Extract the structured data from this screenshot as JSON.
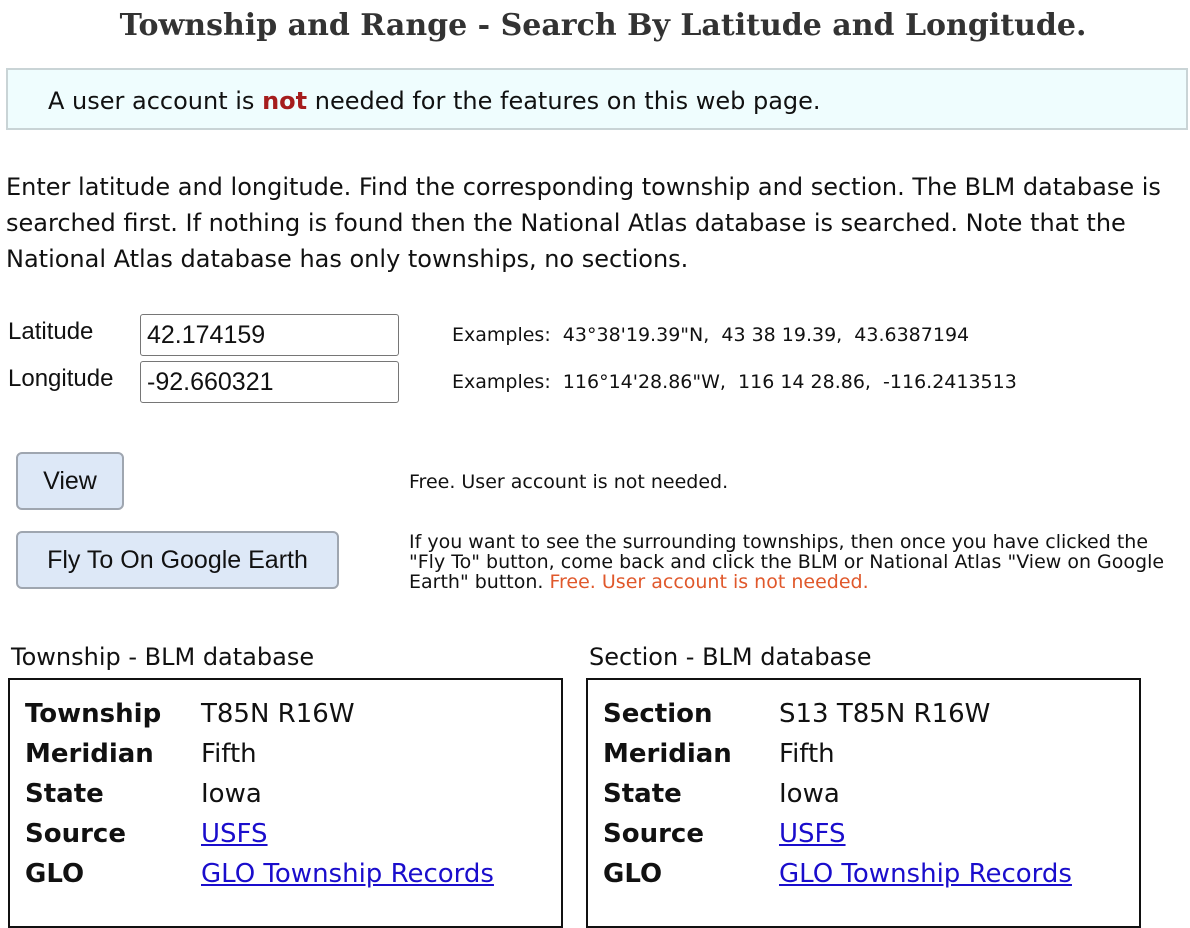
{
  "header": {
    "title": "Township and Range - Search By Latitude and Longitude."
  },
  "notice": {
    "prefix": "A user account is ",
    "emphasis": "not",
    "suffix": " needed for the features on this web page."
  },
  "intro": "Enter latitude and longitude.  Find the corresponding township and section.  The BLM database is searched first.  If nothing is found then the National Atlas database is searched.  Note that the National Atlas database has only townships, no sections.",
  "form": {
    "latitude_label": "Latitude",
    "latitude_value": "42.174159",
    "latitude_examples": "Examples:  43°38'19.39\"N,  43 38 19.39,  43.6387194",
    "longitude_label": "Longitude",
    "longitude_value": "-92.660321",
    "longitude_examples": "Examples:  116°14'28.86\"W,  116 14 28.86,  -116.2413513"
  },
  "actions": {
    "view_label": "View",
    "view_note": "Free. User account is not needed.",
    "fly_label": "Fly To On Google Earth",
    "fly_note": "If you want to see the surrounding townships, then once you have clicked the \"Fly To\" button, come back and click the BLM or National Atlas \"View on Google Earth\" button. ",
    "fly_note_free": "Free. User account is not needed."
  },
  "township": {
    "title": "Township - BLM database",
    "rows": [
      {
        "label": "Township",
        "value": "T85N R16W"
      },
      {
        "label": "Meridian",
        "value": "Fifth"
      },
      {
        "label": "State",
        "value": "Iowa"
      },
      {
        "label": "Source",
        "value": "USFS"
      },
      {
        "label": "GLO",
        "value": "GLO Township Records"
      }
    ]
  },
  "section": {
    "title": "Section - BLM database",
    "rows": [
      {
        "label": "Section",
        "value": "S13 T85N R16W"
      },
      {
        "label": "Meridian",
        "value": "Fifth"
      },
      {
        "label": "State",
        "value": "Iowa"
      },
      {
        "label": "Source",
        "value": "USFS"
      },
      {
        "label": "GLO",
        "value": "GLO Township Records"
      }
    ]
  }
}
